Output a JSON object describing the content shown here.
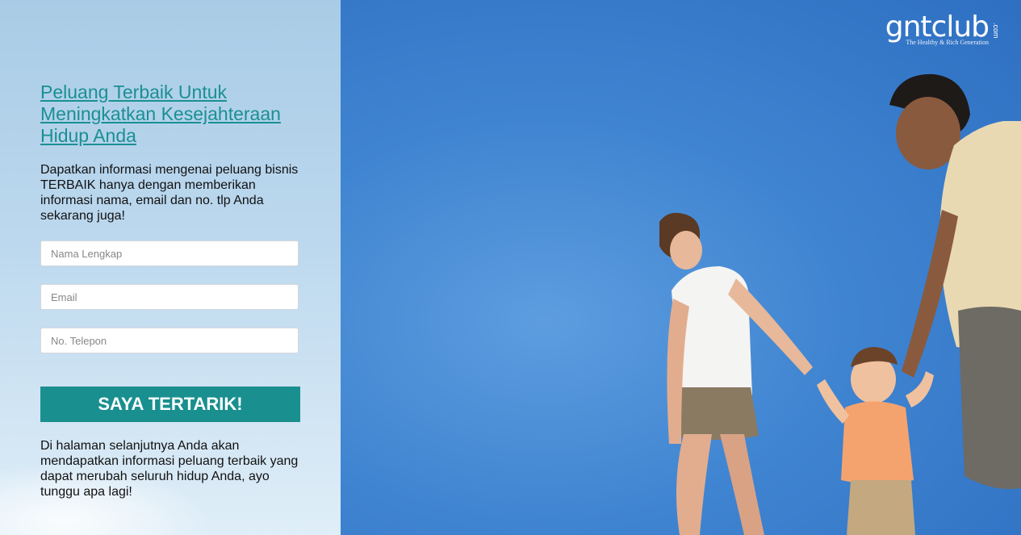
{
  "headline": "Peluang Terbaik Untuk Meningkatkan Kesejahteraan Hidup Anda",
  "intro": "Dapatkan informasi mengenai peluang bisnis TERBAIK hanya dengan memberikan informasi nama, email dan no. tlp Anda sekarang juga!",
  "form": {
    "name_placeholder": "Nama Lengkap",
    "email_placeholder": "Email",
    "phone_placeholder": "No. Telepon",
    "submit_label": "SAYA TERTARIK!"
  },
  "outro": "Di halaman selanjutnya Anda akan mendapatkan informasi peluang terbaik yang dapat merubah seluruh hidup Anda, ayo tunggu apa lagi!",
  "logo": {
    "wordmark": "gntclub",
    "suffix": ".com",
    "tagline": "The Healthy & Rich Generation"
  },
  "colors": {
    "accent": "#1a8f8f",
    "headline": "#1a8f94",
    "sky": "#3f84d1"
  },
  "hero_image": {
    "icon_name": "family-photo"
  }
}
